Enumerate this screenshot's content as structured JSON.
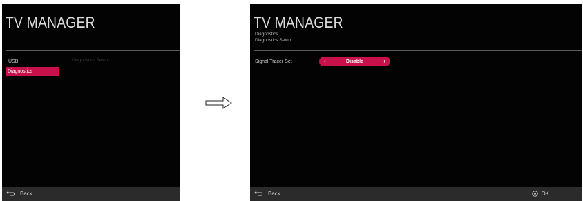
{
  "left": {
    "title": "TV MANAGER",
    "menu": [
      {
        "label": "USB"
      },
      {
        "label": "Diagnostics"
      }
    ],
    "content_label": "Diagnostics Setup",
    "footer": {
      "back_label": "Back",
      "back_icon": "back-arrow-icon"
    }
  },
  "right": {
    "title": "TV MANAGER",
    "breadcrumb": [
      "Diagnostics",
      "Diagnostics Setup"
    ],
    "setting": {
      "label": "Signal Tracer Set",
      "value": "Disable"
    },
    "footer": {
      "back_label": "Back",
      "back_icon": "back-arrow-icon",
      "ok_label": "OK",
      "ok_icon": "ok-button-icon"
    }
  },
  "colors": {
    "accent": "#c8104a",
    "screen_bg": "#030303",
    "footer_bg": "#2b2b2b"
  }
}
